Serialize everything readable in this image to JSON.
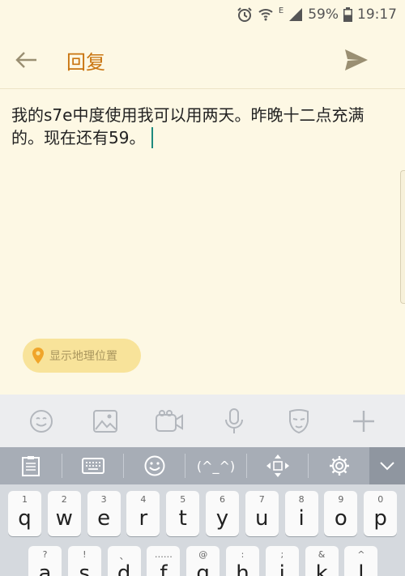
{
  "status_bar": {
    "network_type": "E",
    "battery_percent": "59%",
    "time": "19:17",
    "icons": [
      "alarm-icon",
      "wifi-icon",
      "signal-icon",
      "battery-icon"
    ]
  },
  "app_bar": {
    "title": "回复",
    "back_icon": "back-arrow-icon",
    "send_icon": "send-icon",
    "accent_color": "#c9740f"
  },
  "compose": {
    "text": "我的s7e中度使用我可以用两天。昨晚十二点充满的。现在还有59。"
  },
  "location_chip": {
    "label": "显示地理位置",
    "icon": "location-pin-icon"
  },
  "attachment_bar": {
    "items": [
      "emoji-icon",
      "image-icon",
      "video-icon",
      "microphone-icon",
      "mask-icon",
      "plus-icon"
    ]
  },
  "keyboard_toolbar": {
    "items": [
      "clipboard-icon",
      "keyboard-icon",
      "smiley-icon",
      "kaomoji",
      "cursor-move-icon",
      "settings-icon",
      "collapse-icon"
    ],
    "kaomoji_label": "(^_^)"
  },
  "keyboard": {
    "row1": [
      {
        "hint": "1",
        "char": "q"
      },
      {
        "hint": "2",
        "char": "w"
      },
      {
        "hint": "3",
        "char": "e"
      },
      {
        "hint": "4",
        "char": "r"
      },
      {
        "hint": "5",
        "char": "t"
      },
      {
        "hint": "6",
        "char": "y"
      },
      {
        "hint": "7",
        "char": "u"
      },
      {
        "hint": "8",
        "char": "i"
      },
      {
        "hint": "9",
        "char": "o"
      },
      {
        "hint": "0",
        "char": "p"
      }
    ],
    "row2": [
      {
        "hint": "?",
        "char": "a"
      },
      {
        "hint": "!",
        "char": "s"
      },
      {
        "hint": "、",
        "char": "d"
      },
      {
        "hint": "……",
        "char": "f"
      },
      {
        "hint": "@",
        "char": "g"
      },
      {
        "hint": ":",
        "char": "h"
      },
      {
        "hint": ";",
        "char": "j"
      },
      {
        "hint": "&",
        "char": "k"
      },
      {
        "hint": "^",
        "char": "l"
      }
    ]
  }
}
